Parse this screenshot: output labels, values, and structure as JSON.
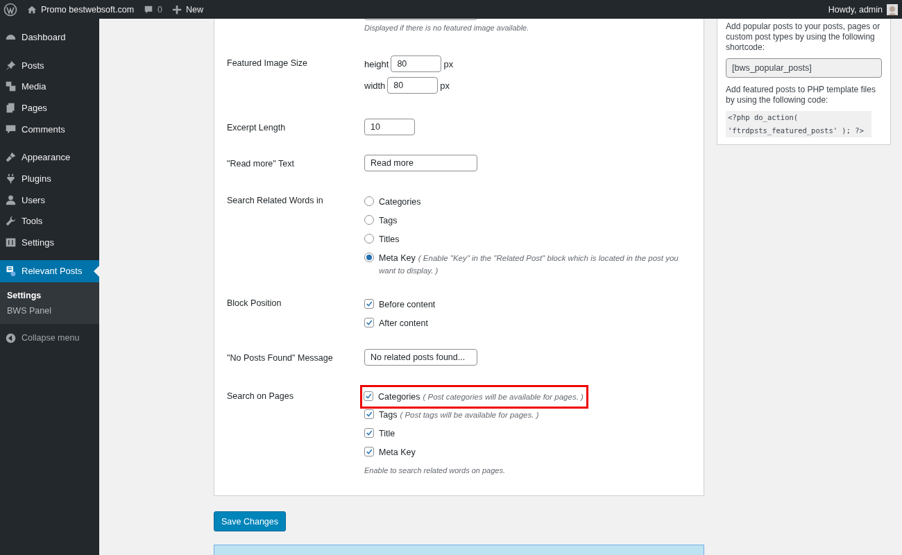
{
  "admin_bar": {
    "site": "Promo bestwebsoft.com",
    "comments": "0",
    "new": "New",
    "greeting": "Howdy, admin"
  },
  "sidebar": {
    "groups": [
      [
        {
          "label": "Dashboard",
          "selected": false
        }
      ],
      [
        {
          "label": "Posts",
          "selected": false
        },
        {
          "label": "Media",
          "selected": false
        },
        {
          "label": "Pages",
          "selected": false
        },
        {
          "label": "Comments",
          "selected": false
        }
      ],
      [
        {
          "label": "Appearance",
          "selected": false
        },
        {
          "label": "Plugins",
          "selected": false
        },
        {
          "label": "Users",
          "selected": false
        },
        {
          "label": "Tools",
          "selected": false
        },
        {
          "label": "Settings",
          "selected": false
        }
      ],
      [
        {
          "label": "Relevant Posts",
          "selected": true,
          "children": [
            {
              "label": "Settings",
              "selected": true
            },
            {
              "label": "BWS Panel",
              "selected": false
            }
          ]
        }
      ]
    ],
    "collapse": "Collapse menu"
  },
  "settings": {
    "top_hint": "Displayed if there is no featured image available.",
    "rows": [
      {
        "kind": "size",
        "label": "Featured Image Size",
        "fields": [
          {
            "label": "height",
            "value": "80",
            "unit": "px"
          },
          {
            "label": "width",
            "value": "80",
            "unit": "px"
          }
        ]
      },
      {
        "kind": "number",
        "label": "Excerpt Length",
        "value": "10"
      },
      {
        "kind": "text",
        "label": "\"Read more\" Text",
        "value": "Read more"
      },
      {
        "kind": "radio",
        "label": "Search Related Words in",
        "options": [
          {
            "label": "Categories",
            "selected": false
          },
          {
            "label": "Tags",
            "selected": false
          },
          {
            "label": "Titles",
            "selected": false
          },
          {
            "label": "Meta Key",
            "note": "( Enable \"Key\" in the \"Related Post\" block which is located in the post you want to display. )",
            "selected": true
          }
        ]
      },
      {
        "kind": "checkbox",
        "label": "Block Position",
        "options": [
          {
            "label": "Before content",
            "checked": true,
            "highlighted": false
          },
          {
            "label": "After content",
            "checked": true,
            "highlighted": false
          }
        ]
      },
      {
        "kind": "text",
        "label": "\"No Posts Found\" Message",
        "value": "No related posts found..."
      },
      {
        "kind": "checkbox",
        "label": "Search on Pages",
        "options": [
          {
            "label": "Categories",
            "note": "( Post categories will be available for pages. )",
            "checked": true,
            "highlighted": true
          },
          {
            "label": "Tags",
            "note": "( Post tags will be available for pages. )",
            "checked": true,
            "highlighted": false
          },
          {
            "label": "Title",
            "checked": true,
            "highlighted": false
          },
          {
            "label": "Meta Key",
            "checked": true,
            "highlighted": false
          }
        ],
        "hint": "Enable to search related words on pages."
      }
    ]
  },
  "save_button": "Save Changes",
  "widget": {
    "intro": "Add popular posts to your posts, pages or custom post types by using the following shortcode:",
    "shortcode": "[bws_popular_posts]",
    "php_intro": "Add featured posts to PHP template files by using the following code:",
    "code": "<?php do_action( 'ftrdpsts_featured_posts' ); ?>"
  }
}
